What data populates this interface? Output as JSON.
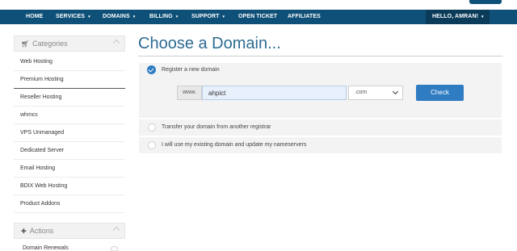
{
  "nav": {
    "items": [
      {
        "label": "HOME",
        "caret": ""
      },
      {
        "label": "SERVICES",
        "caret": "▾"
      },
      {
        "label": "DOMAINS",
        "caret": "▾"
      },
      {
        "label": "BILLING",
        "caret": "▾"
      },
      {
        "label": "SUPPORT",
        "caret": "▾"
      },
      {
        "label": "OPEN TICKET",
        "caret": ""
      },
      {
        "label": "AFFILIATES",
        "caret": ""
      }
    ],
    "user": {
      "label": "HELLO, AMRAN!",
      "caret": "▾"
    }
  },
  "sidebar": {
    "categories_title": "Categories",
    "categories_icon": "cart-icon",
    "items": [
      {
        "label": "Web Hosting"
      },
      {
        "label": "Premium Hosting"
      },
      {
        "label": "Reseller Hosting"
      },
      {
        "label": "whmcs"
      },
      {
        "label": "VPS Unmanaged"
      },
      {
        "label": "Dedicated Server"
      },
      {
        "label": "Email Hosting"
      },
      {
        "label": "BDIX Web Hosting"
      },
      {
        "label": "Product Addons"
      }
    ],
    "actions_title": "Actions",
    "actions_icon": "plus-icon",
    "actions_items": [
      {
        "label": "Domain Renewals"
      }
    ]
  },
  "main": {
    "title": "Choose a Domain...",
    "options": {
      "register": "Register a new domain",
      "transfer": "Transfer your domain from another registrar",
      "existing": "I will use my existing domain and update my nameservers"
    },
    "www_prefix": "www.",
    "domain_value": "ahpict",
    "tld_value": ".com",
    "check_label": "Check"
  },
  "colors": {
    "nav_bg": "#0e5077",
    "accent": "#2f7cc3",
    "title": "#2d6b92"
  }
}
